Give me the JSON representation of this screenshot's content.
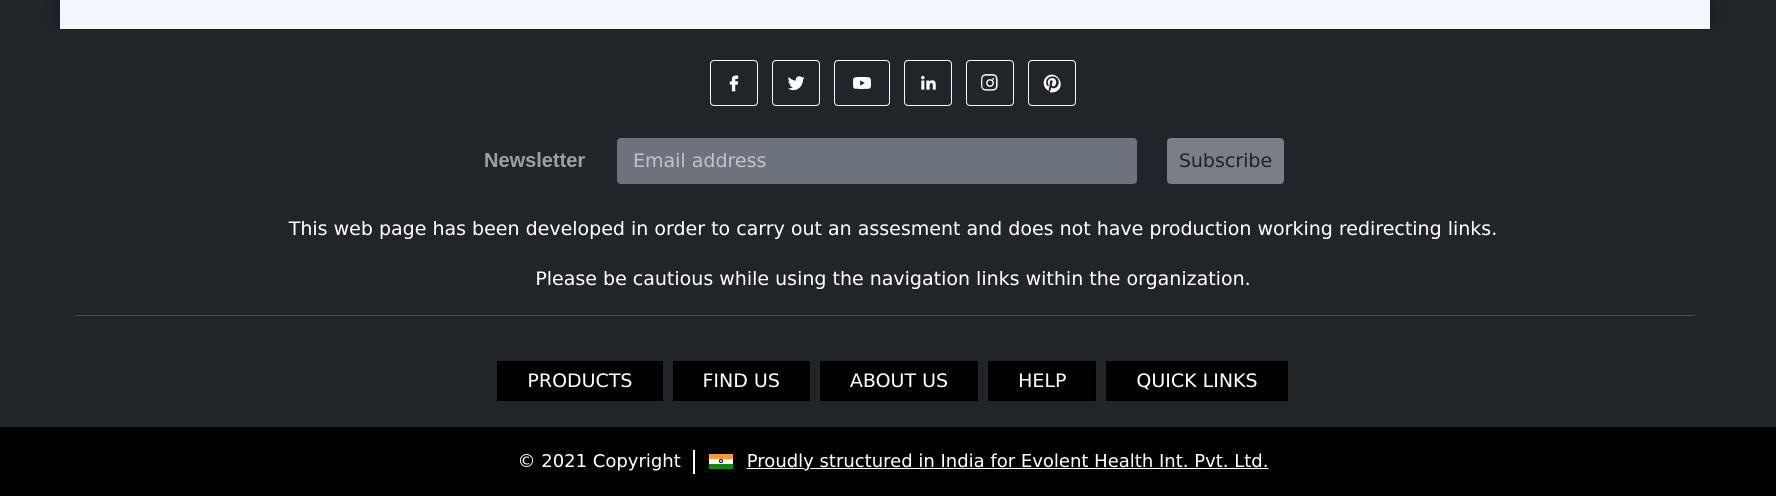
{
  "social": [
    {
      "name": "facebook-icon"
    },
    {
      "name": "twitter-icon"
    },
    {
      "name": "youtube-icon"
    },
    {
      "name": "linkedin-icon"
    },
    {
      "name": "instagram-icon"
    },
    {
      "name": "pinterest-icon"
    }
  ],
  "newsletter": {
    "label": "Newsletter",
    "email_placeholder": "Email address",
    "subscribe_label": "Subscribe"
  },
  "notice": {
    "line1": "This web page has been developed in order to carry out an assesment and does not have production working redirecting links.",
    "line2": "Please be cautious while using the navigation links within the organization."
  },
  "nav": [
    "PRODUCTS",
    "FIND US",
    "ABOUT US",
    "HELP",
    "QUICK LINKS"
  ],
  "footer_bottom": {
    "copyright": "© 2021 Copyright",
    "credit": "Proudly structured in India for Evolent Health Int. Pvt. Ltd."
  },
  "colors": {
    "footer_bg": "#212529",
    "bottom_bg": "#000000",
    "card_bg": "#f1f7fd"
  }
}
